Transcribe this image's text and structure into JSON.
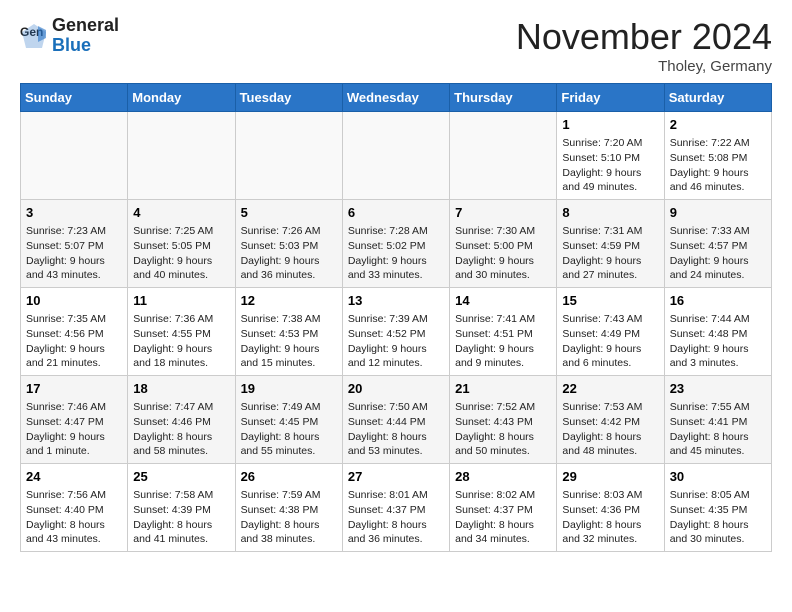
{
  "logo": {
    "general": "General",
    "blue": "Blue"
  },
  "header": {
    "month": "November 2024",
    "location": "Tholey, Germany"
  },
  "weekdays": [
    "Sunday",
    "Monday",
    "Tuesday",
    "Wednesday",
    "Thursday",
    "Friday",
    "Saturday"
  ],
  "weeks": [
    [
      {
        "day": "",
        "info": ""
      },
      {
        "day": "",
        "info": ""
      },
      {
        "day": "",
        "info": ""
      },
      {
        "day": "",
        "info": ""
      },
      {
        "day": "",
        "info": ""
      },
      {
        "day": "1",
        "info": "Sunrise: 7:20 AM\nSunset: 5:10 PM\nDaylight: 9 hours and 49 minutes."
      },
      {
        "day": "2",
        "info": "Sunrise: 7:22 AM\nSunset: 5:08 PM\nDaylight: 9 hours and 46 minutes."
      }
    ],
    [
      {
        "day": "3",
        "info": "Sunrise: 7:23 AM\nSunset: 5:07 PM\nDaylight: 9 hours and 43 minutes."
      },
      {
        "day": "4",
        "info": "Sunrise: 7:25 AM\nSunset: 5:05 PM\nDaylight: 9 hours and 40 minutes."
      },
      {
        "day": "5",
        "info": "Sunrise: 7:26 AM\nSunset: 5:03 PM\nDaylight: 9 hours and 36 minutes."
      },
      {
        "day": "6",
        "info": "Sunrise: 7:28 AM\nSunset: 5:02 PM\nDaylight: 9 hours and 33 minutes."
      },
      {
        "day": "7",
        "info": "Sunrise: 7:30 AM\nSunset: 5:00 PM\nDaylight: 9 hours and 30 minutes."
      },
      {
        "day": "8",
        "info": "Sunrise: 7:31 AM\nSunset: 4:59 PM\nDaylight: 9 hours and 27 minutes."
      },
      {
        "day": "9",
        "info": "Sunrise: 7:33 AM\nSunset: 4:57 PM\nDaylight: 9 hours and 24 minutes."
      }
    ],
    [
      {
        "day": "10",
        "info": "Sunrise: 7:35 AM\nSunset: 4:56 PM\nDaylight: 9 hours and 21 minutes."
      },
      {
        "day": "11",
        "info": "Sunrise: 7:36 AM\nSunset: 4:55 PM\nDaylight: 9 hours and 18 minutes."
      },
      {
        "day": "12",
        "info": "Sunrise: 7:38 AM\nSunset: 4:53 PM\nDaylight: 9 hours and 15 minutes."
      },
      {
        "day": "13",
        "info": "Sunrise: 7:39 AM\nSunset: 4:52 PM\nDaylight: 9 hours and 12 minutes."
      },
      {
        "day": "14",
        "info": "Sunrise: 7:41 AM\nSunset: 4:51 PM\nDaylight: 9 hours and 9 minutes."
      },
      {
        "day": "15",
        "info": "Sunrise: 7:43 AM\nSunset: 4:49 PM\nDaylight: 9 hours and 6 minutes."
      },
      {
        "day": "16",
        "info": "Sunrise: 7:44 AM\nSunset: 4:48 PM\nDaylight: 9 hours and 3 minutes."
      }
    ],
    [
      {
        "day": "17",
        "info": "Sunrise: 7:46 AM\nSunset: 4:47 PM\nDaylight: 9 hours and 1 minute."
      },
      {
        "day": "18",
        "info": "Sunrise: 7:47 AM\nSunset: 4:46 PM\nDaylight: 8 hours and 58 minutes."
      },
      {
        "day": "19",
        "info": "Sunrise: 7:49 AM\nSunset: 4:45 PM\nDaylight: 8 hours and 55 minutes."
      },
      {
        "day": "20",
        "info": "Sunrise: 7:50 AM\nSunset: 4:44 PM\nDaylight: 8 hours and 53 minutes."
      },
      {
        "day": "21",
        "info": "Sunrise: 7:52 AM\nSunset: 4:43 PM\nDaylight: 8 hours and 50 minutes."
      },
      {
        "day": "22",
        "info": "Sunrise: 7:53 AM\nSunset: 4:42 PM\nDaylight: 8 hours and 48 minutes."
      },
      {
        "day": "23",
        "info": "Sunrise: 7:55 AM\nSunset: 4:41 PM\nDaylight: 8 hours and 45 minutes."
      }
    ],
    [
      {
        "day": "24",
        "info": "Sunrise: 7:56 AM\nSunset: 4:40 PM\nDaylight: 8 hours and 43 minutes."
      },
      {
        "day": "25",
        "info": "Sunrise: 7:58 AM\nSunset: 4:39 PM\nDaylight: 8 hours and 41 minutes."
      },
      {
        "day": "26",
        "info": "Sunrise: 7:59 AM\nSunset: 4:38 PM\nDaylight: 8 hours and 38 minutes."
      },
      {
        "day": "27",
        "info": "Sunrise: 8:01 AM\nSunset: 4:37 PM\nDaylight: 8 hours and 36 minutes."
      },
      {
        "day": "28",
        "info": "Sunrise: 8:02 AM\nSunset: 4:37 PM\nDaylight: 8 hours and 34 minutes."
      },
      {
        "day": "29",
        "info": "Sunrise: 8:03 AM\nSunset: 4:36 PM\nDaylight: 8 hours and 32 minutes."
      },
      {
        "day": "30",
        "info": "Sunrise: 8:05 AM\nSunset: 4:35 PM\nDaylight: 8 hours and 30 minutes."
      }
    ]
  ]
}
